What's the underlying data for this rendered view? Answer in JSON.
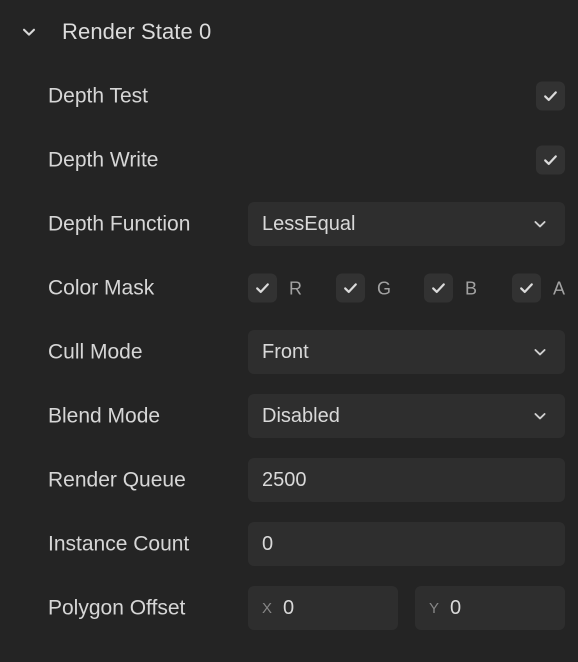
{
  "section": {
    "title": "Render State 0",
    "expanded": true,
    "chevron_icon": "chevron-down-icon"
  },
  "rows": [
    {
      "label": "Depth Test",
      "type": "checkbox",
      "checked": true
    },
    {
      "label": "Depth Write",
      "type": "checkbox",
      "checked": true
    },
    {
      "label": "Depth Function",
      "type": "select",
      "value": "LessEqual",
      "chevron_icon": "chevron-down-icon"
    },
    {
      "label": "Color Mask",
      "type": "mask",
      "channels": [
        {
          "letter": "R",
          "checked": true
        },
        {
          "letter": "G",
          "checked": true
        },
        {
          "letter": "B",
          "checked": true
        },
        {
          "letter": "A",
          "checked": true
        }
      ]
    },
    {
      "label": "Cull Mode",
      "type": "select",
      "value": "Front",
      "chevron_icon": "chevron-down-icon"
    },
    {
      "label": "Blend Mode",
      "type": "select",
      "value": "Disabled",
      "chevron_icon": "chevron-down-icon"
    },
    {
      "label": "Render Queue",
      "type": "number",
      "value": "2500"
    },
    {
      "label": "Instance Count",
      "type": "number",
      "value": "0"
    },
    {
      "label": "Polygon Offset",
      "type": "vector",
      "axes": [
        {
          "axis": "X",
          "value": "0"
        },
        {
          "axis": "Y",
          "value": "0"
        }
      ]
    }
  ],
  "colors": {
    "background": "#242424",
    "field": "#2e2e2e",
    "checkbox": "#323232",
    "label_text": "#d6d6d6",
    "value_text": "#d9d9d9",
    "muted_text": "#868686",
    "check_mark": "#dadada"
  }
}
